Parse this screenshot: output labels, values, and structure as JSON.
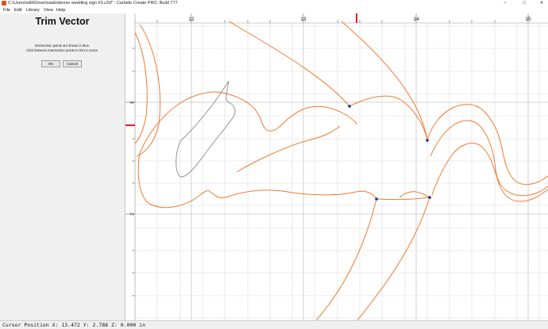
{
  "window": {
    "title": "C:\\Users\\willi\\Downloads\\denise wedding sign #3.c2d* - Carbide Create PRO, Build 777"
  },
  "menu": {
    "items": [
      {
        "label": "File"
      },
      {
        "label": "Edit"
      },
      {
        "label": "Library"
      },
      {
        "label": "View"
      },
      {
        "label": "Help"
      }
    ]
  },
  "panel": {
    "title": "Trim Vector",
    "instructions": [
      "Intersection points are shown in blue.",
      "Click between intersection points to trim a vector."
    ],
    "ok_label": "OK",
    "cancel_label": "Cancel"
  },
  "ruler": {
    "top_labels": [
      "12",
      "13",
      "14",
      "15"
    ],
    "left_labels": [
      "3",
      "2"
    ]
  },
  "colors": {
    "vector": "#f07a2e",
    "selected_vector": "#8a8a8a",
    "intersection": "#1f2a9c",
    "cursor_marker": "#e01b24",
    "grid": "#dcdcdc"
  },
  "status": {
    "cursor_text": "Cursor Position X: 13.472 Y: 2.788 Z: 0.000 in"
  }
}
